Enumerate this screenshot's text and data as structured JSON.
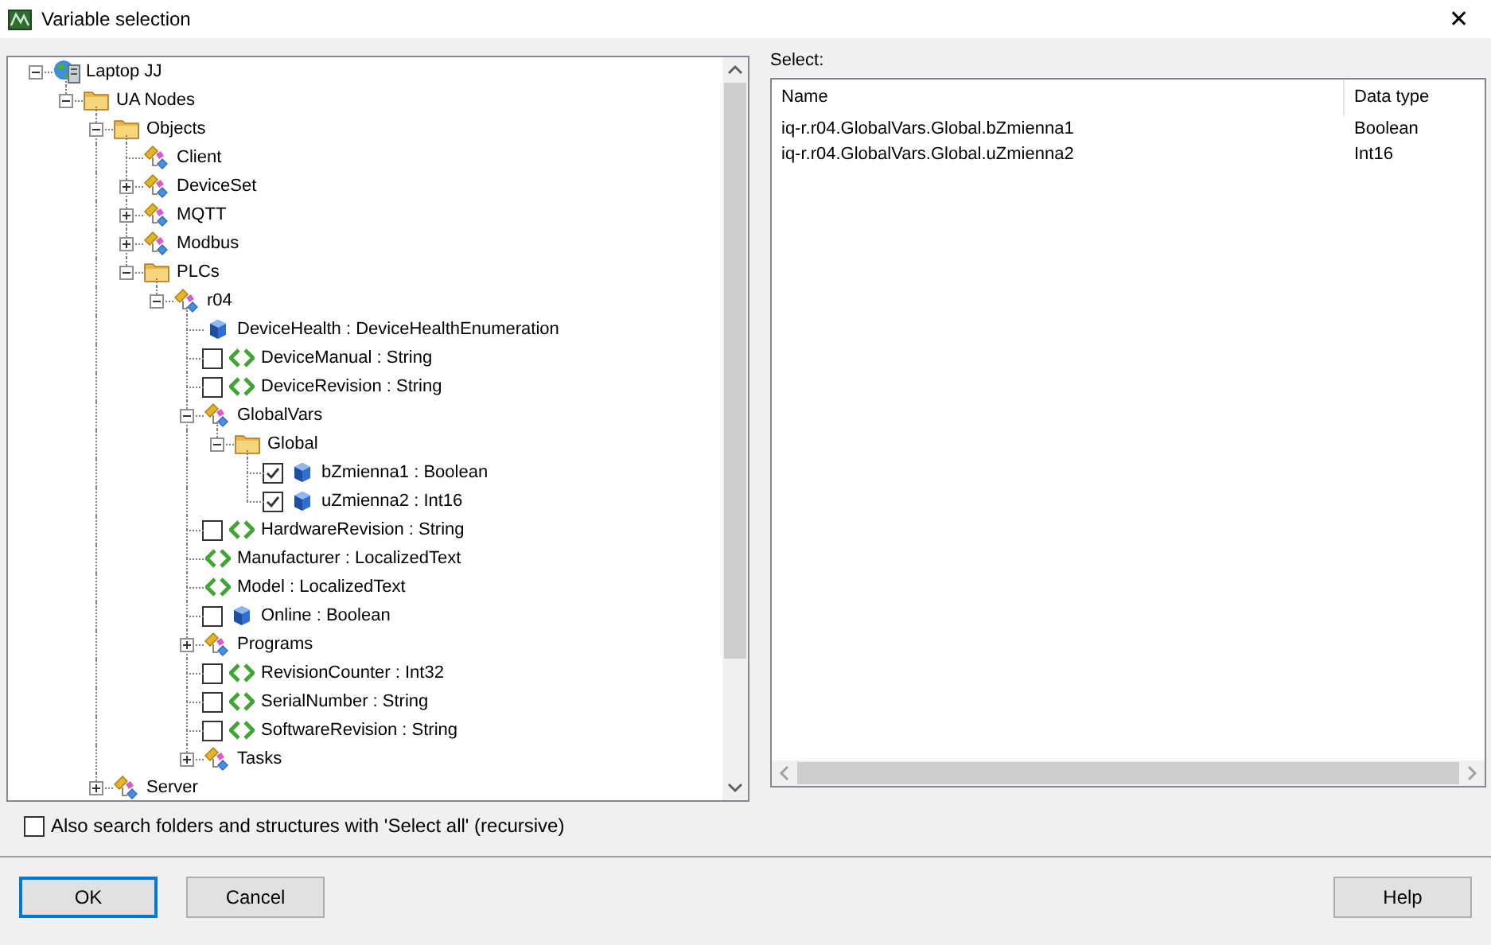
{
  "window": {
    "title": "Variable selection",
    "close": "✕"
  },
  "tree": [
    {
      "label": "Laptop JJ",
      "kind": "computer",
      "expanded": true,
      "children": [
        {
          "label": "UA Nodes",
          "kind": "folder",
          "expanded": true,
          "children": [
            {
              "label": "Objects",
              "kind": "folder",
              "expanded": true,
              "children": [
                {
                  "label": "Client",
                  "kind": "object"
                },
                {
                  "label": "DeviceSet",
                  "kind": "object",
                  "expanded": false
                },
                {
                  "label": "MQTT",
                  "kind": "object",
                  "expanded": false
                },
                {
                  "label": "Modbus",
                  "kind": "object",
                  "expanded": false
                },
                {
                  "label": "PLCs",
                  "kind": "folder",
                  "expanded": true,
                  "children": [
                    {
                      "label": "r04",
                      "kind": "object",
                      "expanded": true,
                      "children": [
                        {
                          "label": "DeviceHealth : DeviceHealthEnumeration",
                          "kind": "variable"
                        },
                        {
                          "label": "DeviceManual : String",
                          "kind": "property",
                          "checked": false
                        },
                        {
                          "label": "DeviceRevision : String",
                          "kind": "property",
                          "checked": false
                        },
                        {
                          "label": "GlobalVars",
                          "kind": "object",
                          "expanded": true,
                          "children": [
                            {
                              "label": "Global",
                              "kind": "folder",
                              "expanded": true,
                              "children": [
                                {
                                  "label": "bZmienna1 : Boolean",
                                  "kind": "variable",
                                  "checked": true
                                },
                                {
                                  "label": "uZmienna2 : Int16",
                                  "kind": "variable",
                                  "checked": true
                                }
                              ]
                            }
                          ]
                        },
                        {
                          "label": "HardwareRevision : String",
                          "kind": "property",
                          "checked": false
                        },
                        {
                          "label": "Manufacturer : LocalizedText",
                          "kind": "property"
                        },
                        {
                          "label": "Model : LocalizedText",
                          "kind": "property"
                        },
                        {
                          "label": "Online : Boolean",
                          "kind": "variable",
                          "checked": false
                        },
                        {
                          "label": "Programs",
                          "kind": "object",
                          "expanded": false
                        },
                        {
                          "label": "RevisionCounter : Int32",
                          "kind": "property",
                          "checked": false
                        },
                        {
                          "label": "SerialNumber : String",
                          "kind": "property",
                          "checked": false
                        },
                        {
                          "label": "SoftwareRevision : String",
                          "kind": "property",
                          "checked": false
                        },
                        {
                          "label": "Tasks",
                          "kind": "object",
                          "expanded": false
                        }
                      ]
                    }
                  ]
                }
              ]
            },
            {
              "label": "Server",
              "kind": "object",
              "expanded": false
            }
          ]
        }
      ]
    }
  ],
  "select": {
    "label": "Select:",
    "columns": [
      "Name",
      "Data type"
    ],
    "rows": [
      [
        "iq-r.r04.GlobalVars.Global.bZmienna1",
        "Boolean"
      ],
      [
        "iq-r.r04.GlobalVars.Global.uZmienna2",
        "Int16"
      ]
    ]
  },
  "recursive_option": {
    "label": "Also search folders and structures with 'Select all' (recursive)",
    "checked": false
  },
  "buttons": [
    {
      "label": "OK",
      "default": true
    },
    {
      "label": "Cancel",
      "default": false
    },
    {
      "label": "Help",
      "default": false
    }
  ]
}
